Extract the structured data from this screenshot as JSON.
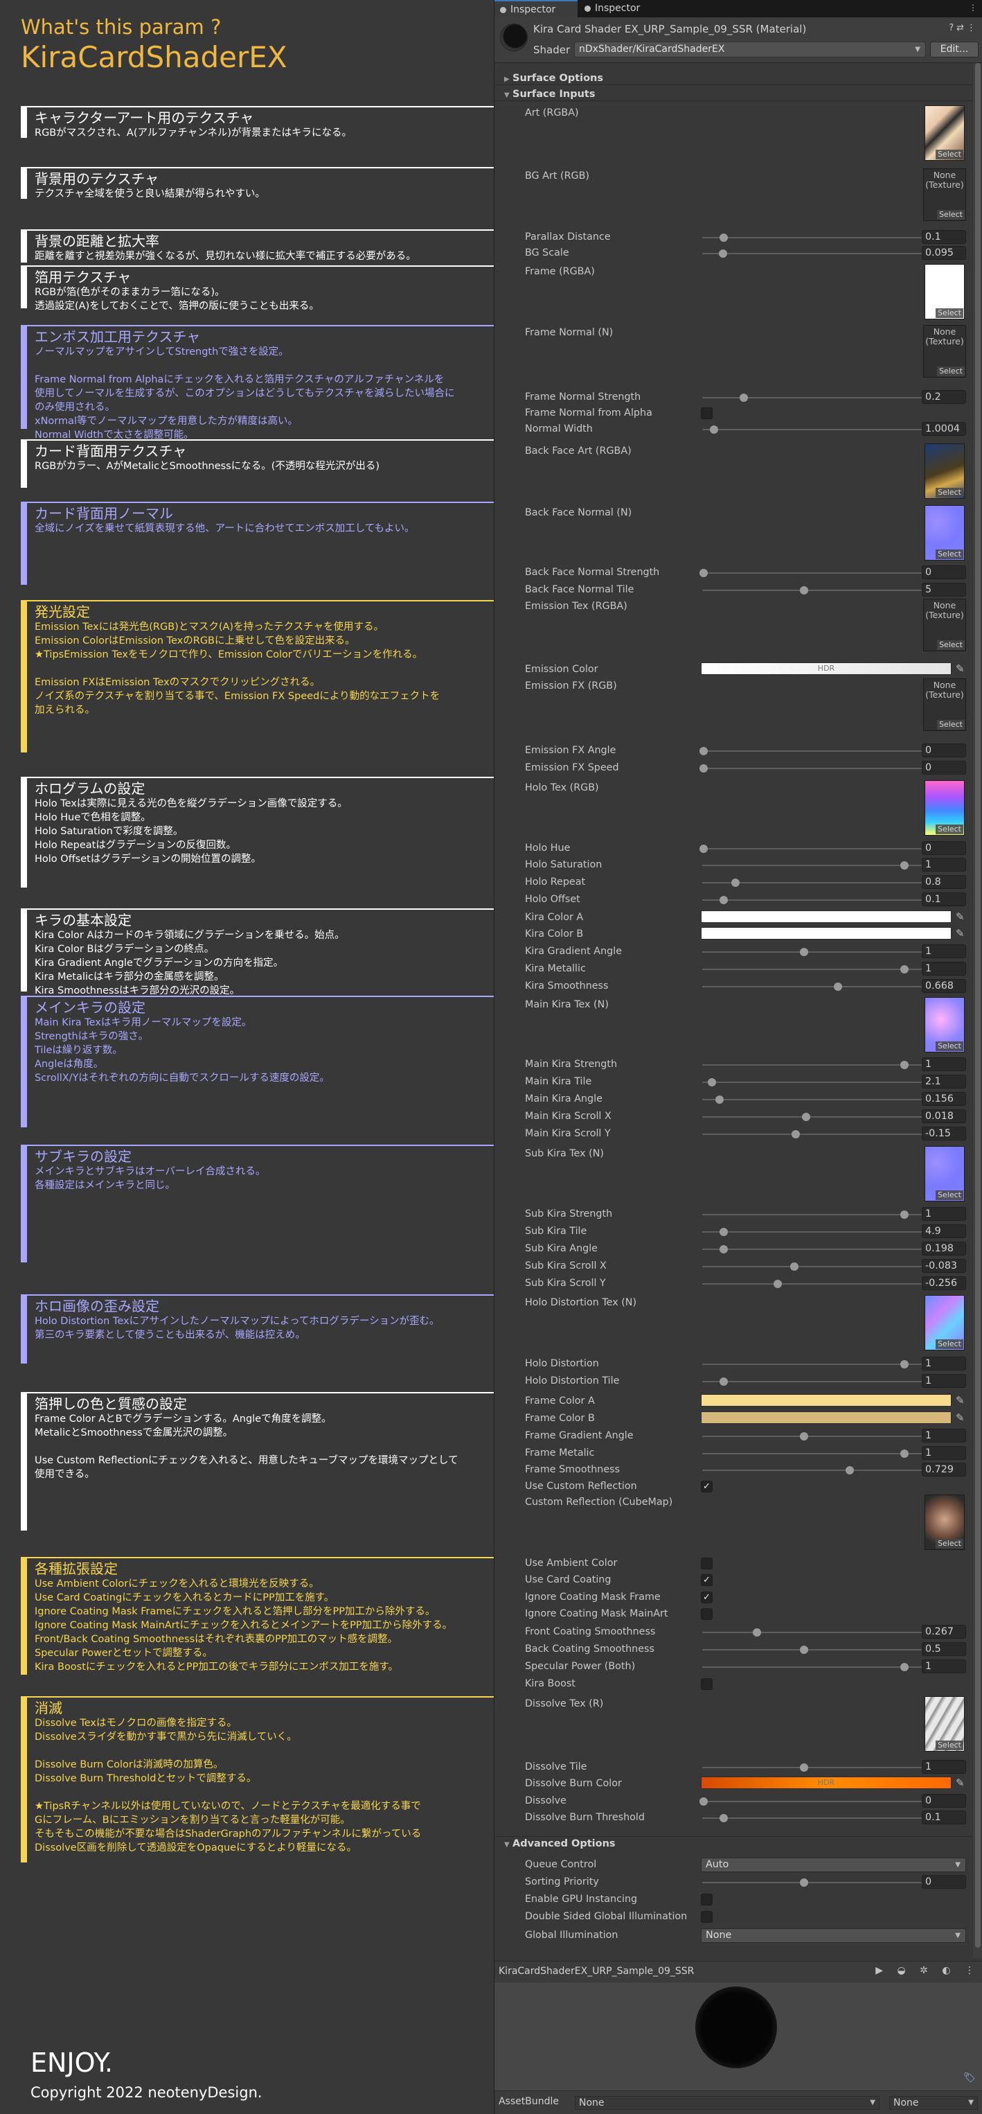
{
  "guide": {
    "whats": "What's this param ?",
    "title": "KiraCardShaderEX",
    "sections": [
      {
        "style": "w",
        "title": "キャラクターアート用のテクスチャ",
        "lines": [
          "RGBがマスクされ、A(アルファチャンネル)が背景またはキラになる。"
        ]
      },
      {
        "style": "w",
        "title": "背景用のテクスチャ",
        "lines": [
          "テクスチャ全域を使うと良い結果が得られやすい。"
        ]
      },
      {
        "style": "w",
        "title": "背景の距離と拡大率",
        "lines": [
          "距離を離すと視差効果が強くなるが、見切れない様に拡大率で補正する必要がある。"
        ]
      },
      {
        "style": "w",
        "title": "箔用テクスチャ",
        "lines": [
          "RGBが箔(色がそのままカラー箔になる)。",
          "透過設定(A)をしておくことで、箔押の版に使うことも出来る。"
        ]
      },
      {
        "style": "p",
        "title": "エンボス加工用テクスチャ",
        "lines": [
          "ノーマルマップをアサインしてStrengthで強さを設定。",
          "",
          "Frame Normal from Alphaにチェックを入れると箔用テクスチャのアルファチャンネルを",
          "使用してノーマルを生成するが、このオプションはどうしてもテクスチャを減らしたい場合に",
          "のみ使用される。",
          "xNormal等でノーマルマップを用意した方が精度は高い。",
          "Normal Widthで太さを調整可能。"
        ]
      },
      {
        "style": "w",
        "title": "カード背面用テクスチャ",
        "lines": [
          "RGBがカラー、AがMetalicとSmoothnessになる。(不透明な程光沢が出る)"
        ]
      },
      {
        "style": "p",
        "title": "カード背面用ノーマル",
        "lines": [
          "全域にノイズを乗せて紙質表現する他、アートに合わせてエンボス加工してもよい。"
        ]
      },
      {
        "style": "y",
        "title": "発光設定",
        "lines": [
          "Emission Texには発光色(RGB)とマスク(A)を持ったテクスチャを使用する。",
          "Emission ColorはEmission TexのRGBに上乗せして色を設定出来る。",
          "★TipsEmission Texをモノクロで作り、Emission Colorでバリエーションを作れる。",
          "",
          "Emission FXはEmission Texのマスクでクリッピングされる。",
          "ノイズ系のテクスチャを割り当てる事で、Emission FX Speedにより動的なエフェクトを",
          "加えられる。"
        ]
      },
      {
        "style": "w",
        "title": "ホログラムの設定",
        "lines": [
          "Holo Texは実際に見える光の色を縦グラデーション画像で設定する。",
          "Holo Hueで色相を調整。",
          "Holo Saturationで彩度を調整。",
          "Holo Repeatはグラデーションの反復回数。",
          "Holo Offsetはグラデーションの開始位置の調整。"
        ]
      },
      {
        "style": "w",
        "title": "キラの基本設定",
        "lines": [
          "Kira Color Aはカードのキラ領域にグラデーションを乗せる。始点。",
          "Kira Color Bはグラデーションの終点。",
          "Kira Gradient Angleでグラデーションの方向を指定。",
          "Kira Metalicはキラ部分の金属感を調整。",
          "Kira Smoothnessはキラ部分の光沢の設定。"
        ]
      },
      {
        "style": "p",
        "title": "メインキラの設定",
        "lines": [
          "Main Kira Texはキラ用ノーマルマップを設定。",
          "Strengthはキラの強さ。",
          "Tileは繰り返す数。",
          "Angleは角度。",
          "ScrollX/Yはそれぞれの方向に自動でスクロールする速度の設定。"
        ]
      },
      {
        "style": "p",
        "title": "サブキラの設定",
        "lines": [
          "メインキラとサブキラはオーバーレイ合成される。",
          "各種設定はメインキラと同じ。"
        ]
      },
      {
        "style": "p",
        "title": "ホロ画像の歪み設定",
        "lines": [
          "Holo Distortion Texにアサインしたノーマルマップによってホログラデーションが歪む。",
          "第三のキラ要素として使うことも出来るが、機能は控えめ。"
        ]
      },
      {
        "style": "w",
        "title": "箔押しの色と質感の設定",
        "lines": [
          "Frame Color AとBでグラデーションする。Angleで角度を調整。",
          "MetalicとSmoothnessで金属光沢の調整。",
          "",
          "Use Custom Reflectionにチェックを入れると、用意したキューブマップを環境マップとして",
          "使用できる。"
        ]
      },
      {
        "style": "y",
        "title": "各種拡張設定",
        "lines": [
          "Use Ambient Colorにチェックを入れると環境光を反映する。",
          "Use Card Coatingにチェックを入れるとカードにPP加工を施す。",
          "Ignore Coating Mask Frameにチェックを入れると箔押し部分をPP加工から除外する。",
          "Ignore Coating Mask MainArtにチェックを入れるとメインアートをPP加工から除外する。",
          "Front/Back Coating Smoothnessはそれぞれ表裏のPP加工のマット感を調整。",
          "Specular Powerとセットで調整する。",
          "Kira Boostにチェックを入れるとPP加工の後でキラ部分にエンボス加工を施す。"
        ]
      },
      {
        "style": "y",
        "title": "消滅",
        "lines": [
          "Dissolve Texはモノクロの画像を指定する。",
          "Dissolveスライダを動かす事で黒から先に消滅していく。",
          "",
          "Dissolve Burn Colorは消滅時の加算色。",
          "Dissolve Burn Thresholdとセットで調整する。",
          "",
          "★TipsRチャンネル以外は使用していないので、ノードとテクスチャを最適化する事で",
          "Gにフレーム、Bにエミッションを割り当てると言った軽量化が可能。",
          "そもそもこの機能が不要な場合はShaderGraphのアルファチャンネルに繋がっている",
          "Dissolve区画を削除して透過設定をOpaqueにするとより軽量になる。"
        ]
      }
    ],
    "enjoy": "ENJOY.",
    "copyright": "Copyright 2022 neotenyDesign."
  },
  "tabs": [
    "Inspector",
    "Inspector"
  ],
  "material": {
    "title": "Kira Card Shader EX_URP_Sample_09_SSR (Material)",
    "shader_label": "Shader",
    "shader_value": "nDxShader/KiraCardShaderEX",
    "edit_label": "Edit...",
    "header_icons": "?⇄⋮"
  },
  "foldouts": [
    "Surface Options",
    "Surface Inputs",
    "Advanced Options"
  ],
  "rows": [
    {
      "type": "tex",
      "label": "Art (RGBA)",
      "thumb": "art"
    },
    {
      "type": "tex",
      "label": "BG Art (RGB)",
      "thumb": "none"
    },
    {
      "type": "slider",
      "label": "Parallax Distance",
      "value": "0.1",
      "pos": 0.1
    },
    {
      "type": "slider",
      "label": "BG Scale",
      "value": "0.095",
      "pos": 0.095
    },
    {
      "type": "tex",
      "label": "Frame (RGBA)",
      "thumb": "white"
    },
    {
      "type": "tex",
      "label": "Frame Normal (N)",
      "thumb": "none"
    },
    {
      "type": "slider",
      "label": "Frame Normal Strength",
      "value": "0.2",
      "pos": 0.2
    },
    {
      "type": "check",
      "label": "Frame Normal from Alpha",
      "checked": false
    },
    {
      "type": "slider",
      "label": "Normal Width",
      "value": "1.0004",
      "pos": 0.05
    },
    {
      "type": "tex",
      "label": "Back Face Art (RGBA)",
      "thumb": "back"
    },
    {
      "type": "tex",
      "label": "Back Face Normal (N)",
      "thumb": "normal"
    },
    {
      "type": "slider",
      "label": "Back Face Normal Strength",
      "value": "0",
      "pos": 0
    },
    {
      "type": "slider",
      "label": "Back Face Normal Tile",
      "value": "5",
      "pos": 0.5
    },
    {
      "type": "tex",
      "label": "Emission Tex (RGBA)",
      "thumb": "none"
    },
    {
      "type": "color",
      "label": "Emission Color",
      "value": "HDR",
      "swatch": "linear-gradient(90deg,#fff,#e4e4e4)"
    },
    {
      "type": "tex",
      "label": "Emission FX (RGB)",
      "thumb": "none"
    },
    {
      "type": "slider",
      "label": "Emission FX Angle",
      "value": "0",
      "pos": 0
    },
    {
      "type": "slider",
      "label": "Emission FX Speed",
      "value": "0",
      "pos": 0
    },
    {
      "type": "tex",
      "label": "Holo Tex (RGB)",
      "thumb": "holo"
    },
    {
      "type": "slider",
      "label": "Holo Hue",
      "value": "0",
      "pos": 0
    },
    {
      "type": "slider",
      "label": "Holo Saturation",
      "value": "1",
      "pos": 1
    },
    {
      "type": "slider",
      "label": "Holo Repeat",
      "value": "0.8",
      "pos": 0.16
    },
    {
      "type": "slider",
      "label": "Holo Offset",
      "value": "0.1",
      "pos": 0.1
    },
    {
      "type": "color",
      "label": "Kira Color A",
      "value": "",
      "swatch": "#ffffff"
    },
    {
      "type": "color",
      "label": "Kira Color B",
      "value": "",
      "swatch": "#ffffff"
    },
    {
      "type": "slider",
      "label": "Kira Gradient Angle",
      "value": "1",
      "pos": 0.5
    },
    {
      "type": "slider",
      "label": "Kira Metallic",
      "value": "1",
      "pos": 1
    },
    {
      "type": "slider",
      "label": "Kira Smoothness",
      "value": "0.668",
      "pos": 0.668
    },
    {
      "type": "tex",
      "label": "Main Kira Tex (N)",
      "thumb": "mainkira"
    },
    {
      "type": "slider",
      "label": "Main Kira Strength",
      "value": "1",
      "pos": 1
    },
    {
      "type": "slider",
      "label": "Main Kira Tile",
      "value": "2.1",
      "pos": 0.04
    },
    {
      "type": "slider",
      "label": "Main Kira Angle",
      "value": "0.156",
      "pos": 0.08
    },
    {
      "type": "slider",
      "label": "Main Kira Scroll X",
      "value": "0.018",
      "pos": 0.51
    },
    {
      "type": "slider",
      "label": "Main Kira Scroll Y",
      "value": "-0.15",
      "pos": 0.46
    },
    {
      "type": "tex",
      "label": "Sub Kira Tex (N)",
      "thumb": "normal"
    },
    {
      "type": "slider",
      "label": "Sub Kira Strength",
      "value": "1",
      "pos": 1
    },
    {
      "type": "slider",
      "label": "Sub Kira Tile",
      "value": "4.9",
      "pos": 0.1
    },
    {
      "type": "slider",
      "label": "Sub Kira Angle",
      "value": "0.198",
      "pos": 0.1
    },
    {
      "type": "slider",
      "label": "Sub Kira Scroll X",
      "value": "-0.083",
      "pos": 0.45
    },
    {
      "type": "slider",
      "label": "Sub Kira Scroll Y",
      "value": "-0.256",
      "pos": 0.37
    },
    {
      "type": "tex",
      "label": "Holo Distortion Tex (N)",
      "thumb": "distort"
    },
    {
      "type": "slider",
      "label": "Holo Distortion",
      "value": "1",
      "pos": 1
    },
    {
      "type": "slider",
      "label": "Holo Distortion Tile",
      "value": "1",
      "pos": 0.1
    },
    {
      "type": "color",
      "label": "Frame Color A",
      "value": "",
      "swatch": "#f6dc8c"
    },
    {
      "type": "color",
      "label": "Frame Color B",
      "value": "",
      "swatch": "#d6b87a"
    },
    {
      "type": "slider",
      "label": "Frame Gradient Angle",
      "value": "1",
      "pos": 0.5
    },
    {
      "type": "slider",
      "label": "Frame Metalic",
      "value": "1",
      "pos": 1
    },
    {
      "type": "slider",
      "label": "Frame Smoothness",
      "value": "0.729",
      "pos": 0.729
    },
    {
      "type": "check",
      "label": "Use Custom Reflection",
      "checked": true
    },
    {
      "type": "tex",
      "label": "Custom Reflection (CubeMap)",
      "thumb": "cube"
    },
    {
      "type": "check",
      "label": "Use Ambient Color",
      "checked": false
    },
    {
      "type": "check",
      "label": "Use Card Coating",
      "checked": true
    },
    {
      "type": "check",
      "label": "Ignore Coating Mask Frame",
      "checked": true
    },
    {
      "type": "check",
      "label": "Ignore Coating Mask MainArt",
      "checked": false
    },
    {
      "type": "slider",
      "label": "Front Coating Smoothness",
      "value": "0.267",
      "pos": 0.267
    },
    {
      "type": "slider",
      "label": "Back Coating Smoothness",
      "value": "0.5",
      "pos": 0.5
    },
    {
      "type": "slider",
      "label": "Specular Power (Both)",
      "value": "1",
      "pos": 1
    },
    {
      "type": "check",
      "label": "Kira Boost",
      "checked": false
    },
    {
      "type": "tex",
      "label": "Dissolve Tex (R)",
      "thumb": "dissolve"
    },
    {
      "type": "slider",
      "label": "Dissolve Tile",
      "value": "1",
      "pos": 0.5
    },
    {
      "type": "color",
      "label": "Dissolve Burn Color",
      "value": "HDR",
      "swatch": "linear-gradient(90deg,#d94a00,#ff8c00,#ff6a00)"
    },
    {
      "type": "slider",
      "label": "Dissolve",
      "value": "0",
      "pos": 0
    },
    {
      "type": "slider",
      "label": "Dissolve Burn Threshold",
      "value": "0.1",
      "pos": 0.1
    },
    {
      "type": "dropdown",
      "label": "Queue Control",
      "value": "Auto"
    },
    {
      "type": "slider",
      "label": "Sorting Priority",
      "value": "0",
      "pos": 0.5
    },
    {
      "type": "check",
      "label": "Enable GPU Instancing",
      "checked": false
    },
    {
      "type": "check",
      "label": "Double Sided Global Illumination",
      "checked": false
    },
    {
      "type": "dropdown",
      "label": "Global Illumination",
      "value": "None"
    }
  ],
  "tex_texts": {
    "none_line1": "None",
    "none_line2": "(Texture)",
    "select": "Select"
  },
  "preview": {
    "title": "KiraCardShaderEX_URP_Sample_09_SSR"
  },
  "assetbundle": {
    "label": "AssetBundle",
    "value1": "None",
    "value2": "None"
  }
}
